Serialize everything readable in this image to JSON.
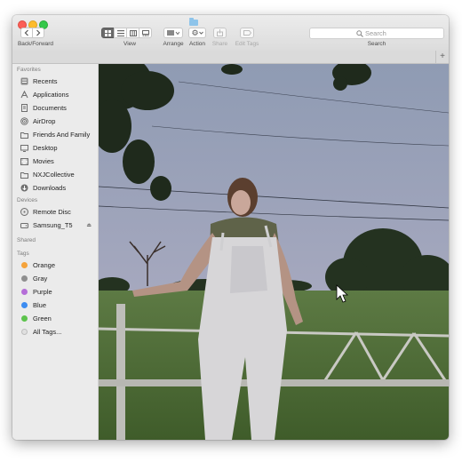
{
  "toolbar": {
    "back_forward_label": "Back/Forward",
    "view_label": "View",
    "arrange_label": "Arrange",
    "action_label": "Action",
    "share_label": "Share",
    "edit_tags_label": "Edit Tags",
    "search_placeholder": "Search",
    "search_label": "Search"
  },
  "sidebar": {
    "favorites_title": "Favorites",
    "favorites": [
      {
        "label": "Recents",
        "icon": "recents-icon"
      },
      {
        "label": "Applications",
        "icon": "applications-icon"
      },
      {
        "label": "Documents",
        "icon": "documents-icon"
      },
      {
        "label": "AirDrop",
        "icon": "airdrop-icon"
      },
      {
        "label": "Friends And Family",
        "icon": "folder-icon"
      },
      {
        "label": "Desktop",
        "icon": "desktop-icon"
      },
      {
        "label": "Movies",
        "icon": "movies-icon"
      },
      {
        "label": "NXJCollective",
        "icon": "folder-icon"
      },
      {
        "label": "Downloads",
        "icon": "downloads-icon"
      }
    ],
    "devices_title": "Devices",
    "devices": [
      {
        "label": "Remote Disc",
        "icon": "disc-icon"
      },
      {
        "label": "Samsung_T5",
        "icon": "drive-icon"
      }
    ],
    "shared_title": "Shared",
    "tags_title": "Tags",
    "tags": [
      {
        "label": "Orange",
        "color": "#f5a33b"
      },
      {
        "label": "Gray",
        "color": "#8f8f8f"
      },
      {
        "label": "Purple",
        "color": "#b56ed8"
      },
      {
        "label": "Blue",
        "color": "#3c8cf1"
      },
      {
        "label": "Green",
        "color": "#5cc34c"
      },
      {
        "label": "All Tags...",
        "color": "#e0e0e0"
      }
    ]
  },
  "colors": {
    "sky_top": "#8f9bb3",
    "sky_bottom": "#b7acc0",
    "grass": "#4b6a35",
    "selected_segment": "#6a6a6a"
  }
}
